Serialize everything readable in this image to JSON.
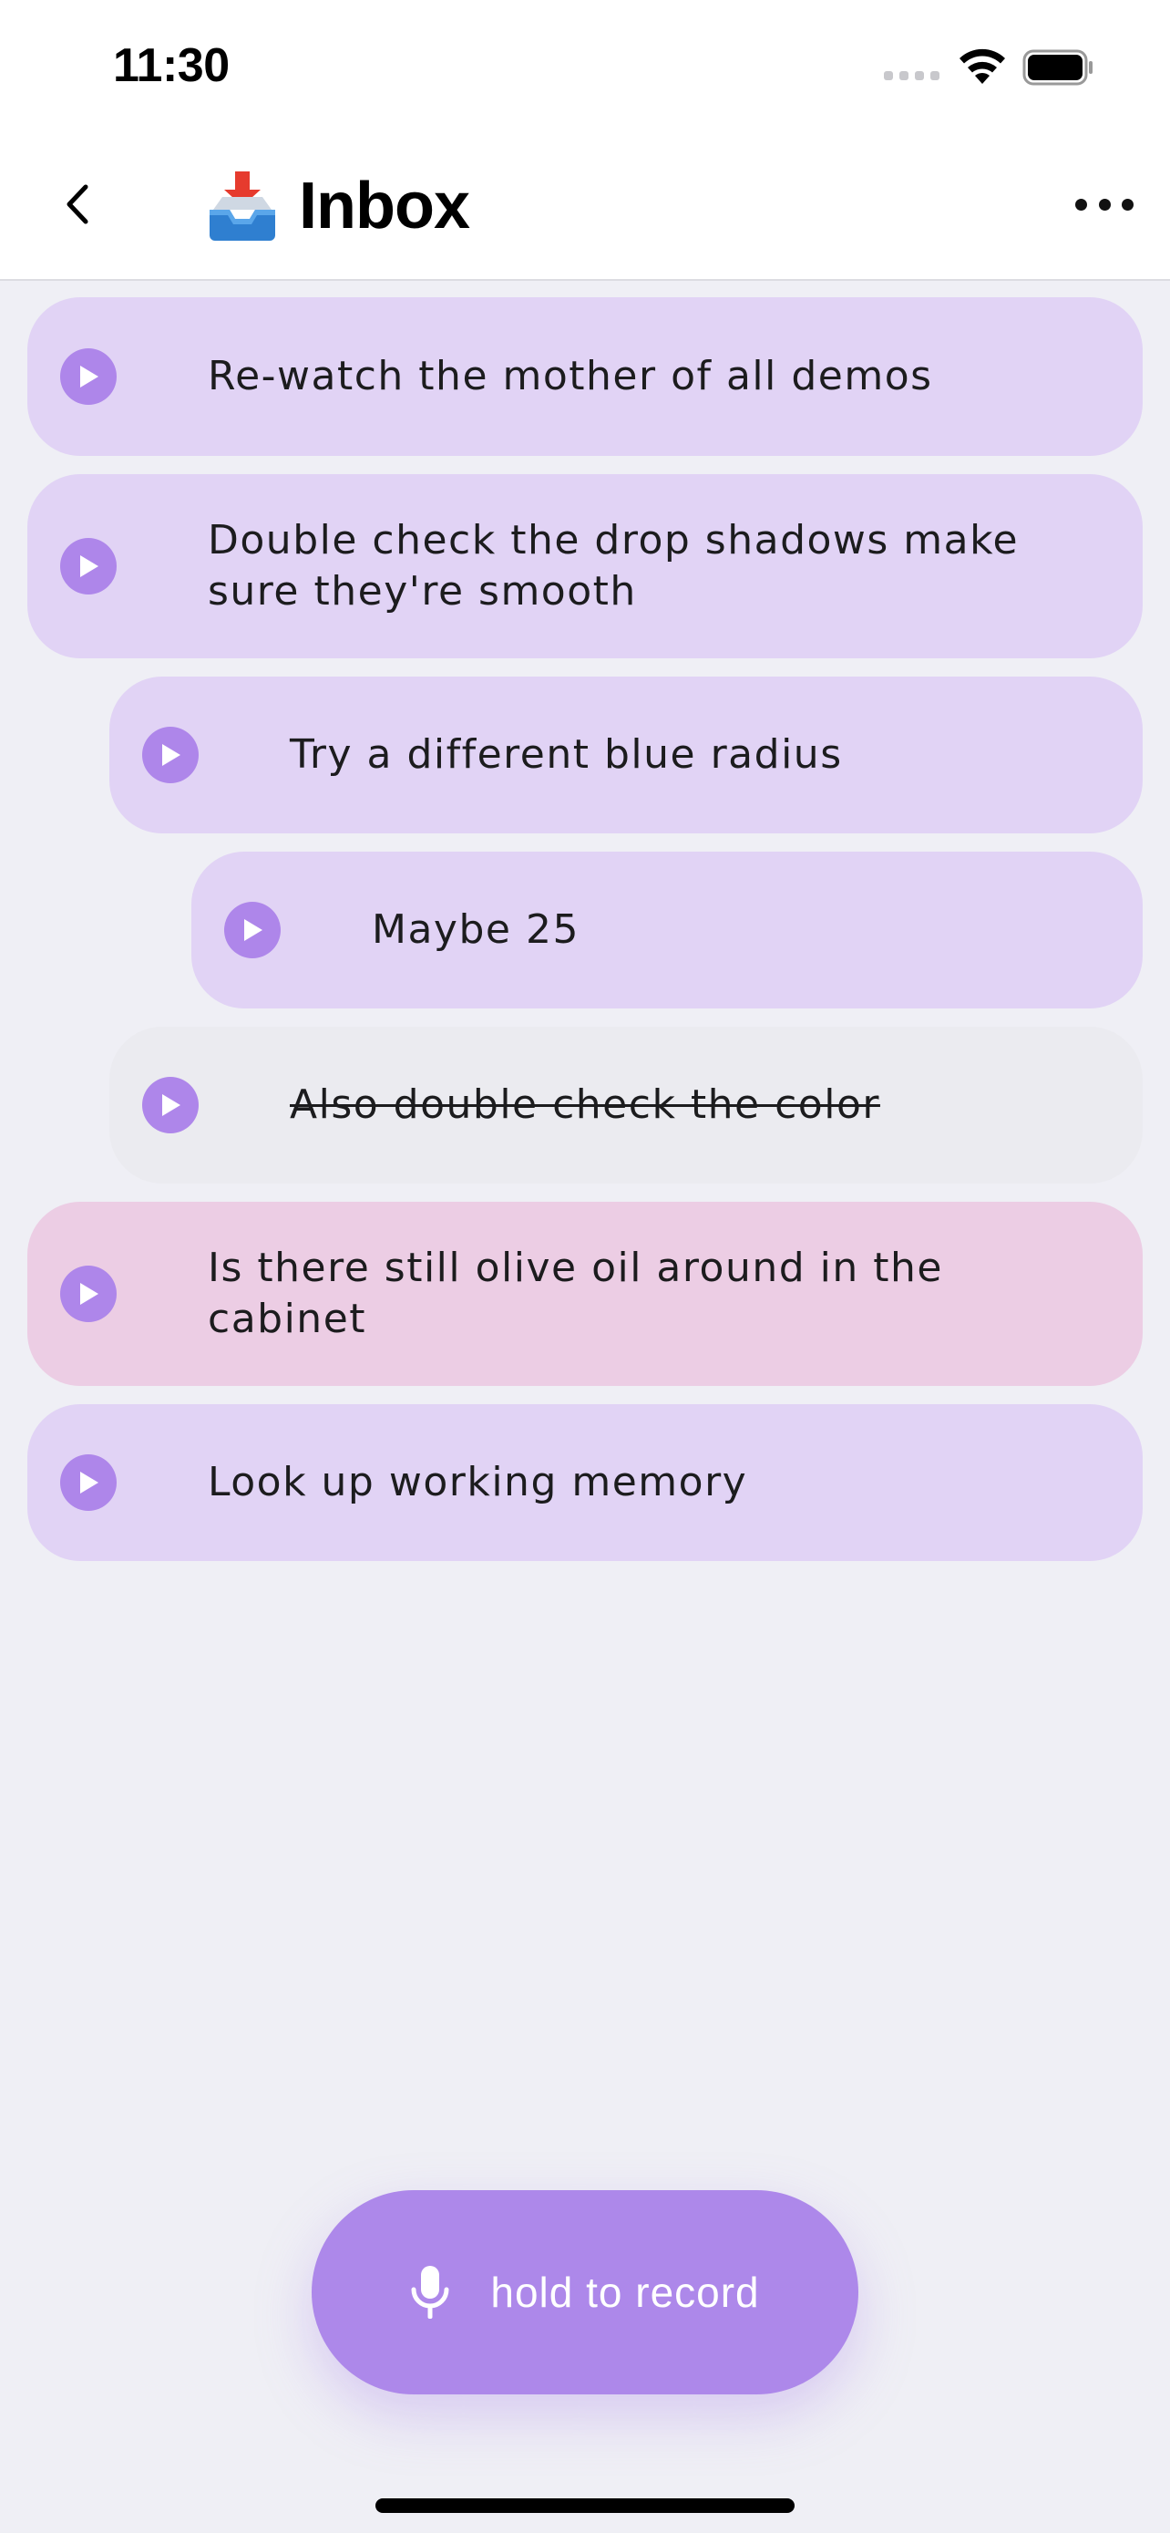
{
  "status_bar": {
    "time": "11:30"
  },
  "header": {
    "title": "Inbox"
  },
  "items": [
    {
      "text": "Re-watch the mother of all demos",
      "color": "#e1d3f5",
      "state": "open",
      "indent": 0
    },
    {
      "text": "Double check the drop shadows make sure they're smooth",
      "color": "#e1d3f5",
      "state": "open",
      "indent": 0
    },
    {
      "text": "Try a different blue radius",
      "color": "#e1d3f5",
      "state": "open",
      "indent": 1
    },
    {
      "text": "Maybe 25",
      "color": "#e1d3f5",
      "state": "open",
      "indent": 2
    },
    {
      "text": "Also double check the color",
      "color": "#ebebf0",
      "state": "completed",
      "indent": 1
    },
    {
      "text": "Is there still olive oil around in the cabinet",
      "color": "#eccde4",
      "state": "open",
      "indent": 0
    },
    {
      "text": "Look up working memory",
      "color": "#e1d3f5",
      "state": "open",
      "indent": 0
    }
  ],
  "record_button": {
    "label": "hold to record"
  },
  "colors": {
    "accent": "#ad88ea",
    "play": "#ae86ea",
    "background": "#efeff5"
  },
  "icons": [
    "back-chevron-icon",
    "inbox-tray-icon",
    "more-icon",
    "play-icon",
    "microphone-icon"
  ]
}
